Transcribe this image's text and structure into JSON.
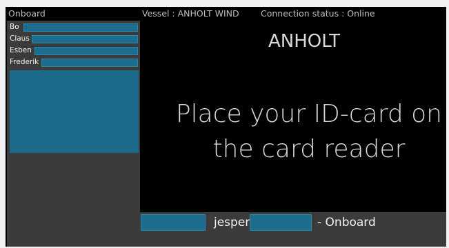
{
  "left": {
    "header": "Onboard",
    "crew": [
      {
        "name": "Bo"
      },
      {
        "name": "Claus"
      },
      {
        "name": "Esben"
      },
      {
        "name": "Frederik"
      }
    ]
  },
  "top": {
    "vessel": "Vessel : ANHOLT WIND",
    "connection": "Connection status : Online"
  },
  "main": {
    "location": "ANHOLT",
    "instruction_line1": "Place your ID-card on",
    "instruction_line2": "the card reader"
  },
  "status": {
    "user": "jesper",
    "suffix": "- Onboard"
  },
  "colors": {
    "field_blue": "#1d6e8e",
    "panel_gray": "#3b3b3b",
    "background": "#000000"
  }
}
